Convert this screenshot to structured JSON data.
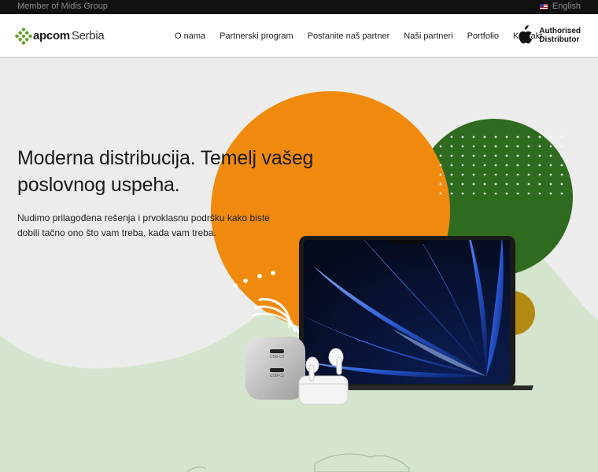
{
  "topbar": {
    "member_text": "Member of Midis Group",
    "language": "English",
    "language_icon": "us-flag-icon"
  },
  "header": {
    "logo": {
      "brand": "apcom",
      "region": "Serbia"
    },
    "nav": [
      {
        "label": "O nama"
      },
      {
        "label": "Partnerski program"
      },
      {
        "label": "Postanite naš partner"
      },
      {
        "label": "Naši partneri"
      },
      {
        "label": "Portfolio"
      },
      {
        "label": "Kontakt"
      }
    ],
    "badge": {
      "line1": "Authorised",
      "line2": "Distributor",
      "icon": "apple-logo-icon"
    }
  },
  "hero": {
    "headline_line1": "Moderna distribucija. Temelj vašeg",
    "headline_line2": "poslovnog uspeha.",
    "sub_line1": "Nudimo prilagođena rešenja i prvoklasnu podršku kako biste",
    "sub_line2": "dobili tačno ono što vam treba, kada vam treba.",
    "charger_port_1": "USB-C2",
    "charger_port_2": "USB-C1"
  },
  "colors": {
    "orange": "#f08a0e",
    "green": "#2e6b1e",
    "olive": "#b08a12",
    "light_green": "#d4e3cb",
    "brand_green": "#6a9a2c"
  }
}
